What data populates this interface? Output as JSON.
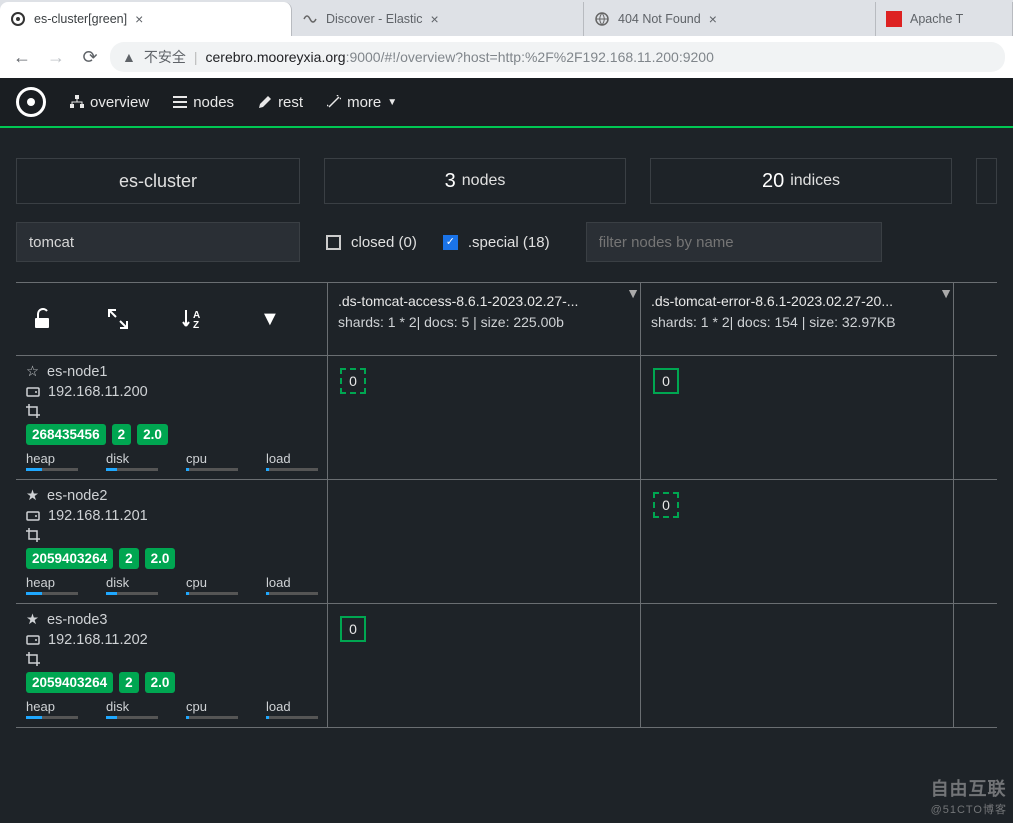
{
  "browser": {
    "tabs": [
      {
        "title": "es-cluster[green]",
        "active": true
      },
      {
        "title": "Discover - Elastic",
        "active": false
      },
      {
        "title": "404 Not Found",
        "active": false
      },
      {
        "title": "Apache T",
        "active": false
      }
    ],
    "insecure_label": "不安全",
    "url_host": "cerebro.mooreyxia.org",
    "url_port": ":9000",
    "url_path": "/#!/overview?host=http:%2F%2F192.168.11.200:9200"
  },
  "nav": {
    "overview": "overview",
    "nodes": "nodes",
    "rest": "rest",
    "more": "more"
  },
  "stats": {
    "cluster_name": "es-cluster",
    "nodes_count": "3",
    "nodes_label": "nodes",
    "indices_count": "20",
    "indices_label": "indices"
  },
  "filters": {
    "index_filter_value": "tomcat",
    "closed_label": "closed (0)",
    "closed_checked": false,
    "special_label": ".special (18)",
    "special_checked": true,
    "node_placeholder": "filter nodes by name"
  },
  "indices": [
    {
      "title": ".ds-tomcat-access-8.6.1-2023.02.27-...",
      "meta": "shards: 1 * 2| docs: 5 | size: 225.00b"
    },
    {
      "title": ".ds-tomcat-error-8.6.1-2023.02.27-20...",
      "meta": "shards: 1 * 2| docs: 154 | size: 32.97KB"
    }
  ],
  "nodes": [
    {
      "name": "es-node1",
      "ip": "192.168.11.200",
      "badges": [
        "268435456",
        "2",
        "2.0"
      ],
      "metrics": {
        "heap": "heap",
        "disk": "disk",
        "cpu": "cpu",
        "load": "load"
      },
      "shards": [
        {
          "idx": 0,
          "v": "0",
          "dashed": true
        },
        {
          "idx": 1,
          "v": "0",
          "dashed": false
        }
      ]
    },
    {
      "name": "es-node2",
      "ip": "192.168.11.201",
      "badges": [
        "2059403264",
        "2",
        "2.0"
      ],
      "metrics": {
        "heap": "heap",
        "disk": "disk",
        "cpu": "cpu",
        "load": "load"
      },
      "shards": [
        null,
        {
          "idx": 1,
          "v": "0",
          "dashed": true
        }
      ]
    },
    {
      "name": "es-node3",
      "ip": "192.168.11.202",
      "badges": [
        "2059403264",
        "2",
        "2.0"
      ],
      "metrics": {
        "heap": "heap",
        "disk": "disk",
        "cpu": "cpu",
        "load": "load"
      },
      "shards": [
        {
          "idx": 0,
          "v": "0",
          "dashed": false
        },
        null
      ]
    }
  ],
  "watermark": {
    "brand": "自由互联",
    "sub": "@51CTO博客"
  }
}
